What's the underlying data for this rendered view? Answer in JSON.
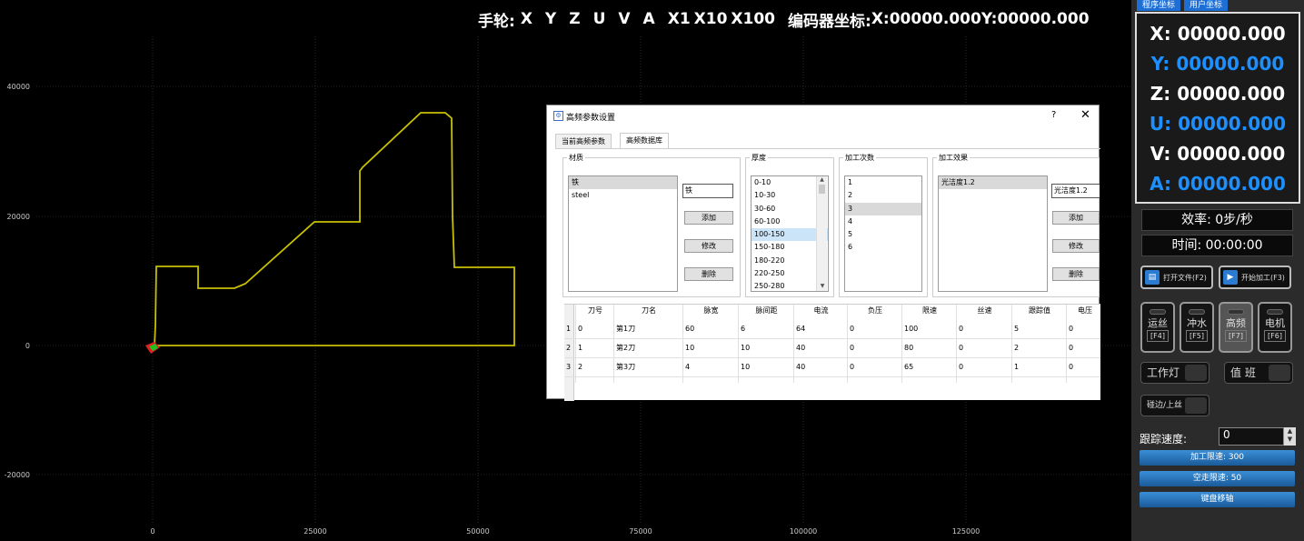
{
  "plot": {
    "handwheel_label": "手轮:",
    "axes": [
      "X",
      "Y",
      "Z",
      "U",
      "V",
      "A"
    ],
    "multipliers": [
      "X1",
      "X10",
      "X100"
    ],
    "encoder_label": "编码器坐标:",
    "encoder_x": "X:00000.000",
    "encoder_y": "Y:00000.000",
    "y_ticks": [
      "40000",
      "20000",
      "0",
      "-20000"
    ],
    "x_ticks": [
      "0",
      "25000",
      "50000",
      "75000",
      "100000",
      "125000"
    ],
    "path_color": "#c8c000"
  },
  "panel": {
    "tab_program": "程序坐标",
    "tab_user": "用户坐标",
    "coords": [
      {
        "text": "X: 00000.000",
        "color": "#ffffff"
      },
      {
        "text": "Y: 00000.000",
        "color": "#1e8fff"
      },
      {
        "text": "Z: 00000.000",
        "color": "#ffffff"
      },
      {
        "text": "U: 00000.000",
        "color": "#1e8fff"
      },
      {
        "text": "V: 00000.000",
        "color": "#ffffff"
      },
      {
        "text": "A: 00000.000",
        "color": "#1e8fff"
      }
    ],
    "efficiency": "效率:  0步/秒",
    "time": "时间:  00:00:00",
    "open_file": "打开文件(F2)",
    "start_machining": "开始加工(F3)",
    "toggles": [
      {
        "label": "运丝",
        "key": "[F4]"
      },
      {
        "label": "冲水",
        "key": "[F5]"
      },
      {
        "label": "高频",
        "key": "[F7]"
      },
      {
        "label": "电机",
        "key": "[F6]"
      }
    ],
    "work_light": "工作灯",
    "on_duty": "值 班",
    "edge_wire": "碰边/上丝",
    "track_speed_label": "跟踪速度:",
    "track_speed_value": "0",
    "machining_limit": "加工限速: 300",
    "idle_limit": "空走限速: 50",
    "keyboard_move": "键盘移轴"
  },
  "dialog": {
    "title": "高频参数设置",
    "help": "?",
    "close": "✕",
    "tabs": [
      "当前高频参数",
      "高频数据库"
    ],
    "material_group": "材质",
    "materials": [
      "铁",
      "steel"
    ],
    "material_input": "铁",
    "thickness_group": "厚度",
    "thicknesses": [
      "0-10",
      "10-30",
      "30-60",
      "60-100",
      "100-150",
      "150-180",
      "180-220",
      "220-250",
      "250-280"
    ],
    "passes_group": "加工次数",
    "passes": [
      "1",
      "2",
      "3",
      "4",
      "5",
      "6"
    ],
    "effect_group": "加工效果",
    "effects": [
      "光洁度1.2"
    ],
    "effect_input": "光洁度1.2",
    "add": "添加",
    "modify": "修改",
    "delete": "删除",
    "columns": [
      "刀号",
      "刀名",
      "脉宽",
      "脉间距",
      "电流",
      "负压",
      "限速",
      "丝速",
      "跟踪值",
      "电压"
    ],
    "rows": [
      {
        "idx": "1",
        "cells": [
          "0",
          "第1刀",
          "60",
          "6",
          "64",
          "0",
          "100",
          "0",
          "5",
          "0"
        ]
      },
      {
        "idx": "2",
        "cells": [
          "1",
          "第2刀",
          "10",
          "10",
          "40",
          "0",
          "80",
          "0",
          "2",
          "0"
        ]
      },
      {
        "idx": "3",
        "cells": [
          "2",
          "第3刀",
          "4",
          "10",
          "40",
          "0",
          "65",
          "0",
          "1",
          "0"
        ]
      }
    ]
  }
}
